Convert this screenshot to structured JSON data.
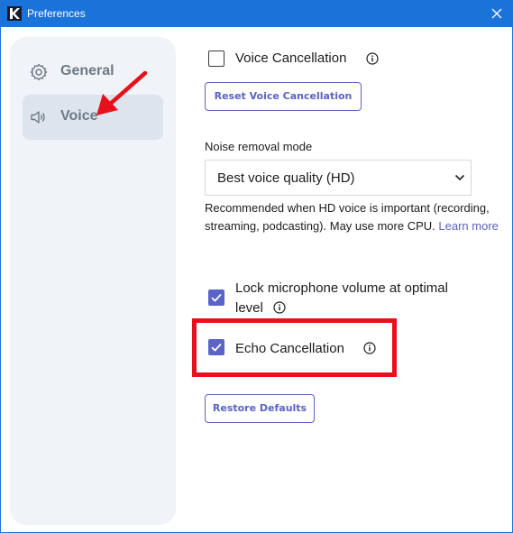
{
  "window": {
    "title": "Preferences"
  },
  "sidebar": {
    "items": [
      {
        "label": "General",
        "icon": "gear-icon",
        "active": false
      },
      {
        "label": "Voice",
        "icon": "speaker-icon",
        "active": true
      }
    ]
  },
  "voice": {
    "voice_cancellation": {
      "label": "Voice Cancellation",
      "checked": false
    },
    "reset_button": "Reset Voice Cancellation",
    "noise_mode": {
      "label": "Noise removal mode",
      "selected": "Best voice quality (HD)",
      "description": "Recommended when HD voice is important (recording, streaming, podcasting). May use more CPU.",
      "learn_more": "Learn more"
    },
    "lock_mic": {
      "label_line1": "Lock microphone volume at optimal",
      "label_line2": "level",
      "checked": true
    },
    "echo_cancellation": {
      "label": "Echo Cancellation",
      "checked": true
    },
    "restore_button": "Restore Defaults"
  },
  "colors": {
    "titlebar": "#1a73d9",
    "accent": "#5a63c8",
    "annotation": "#e8101a",
    "sidebar_bg": "#f0f3f7",
    "sidebar_active": "#dde4ee"
  }
}
